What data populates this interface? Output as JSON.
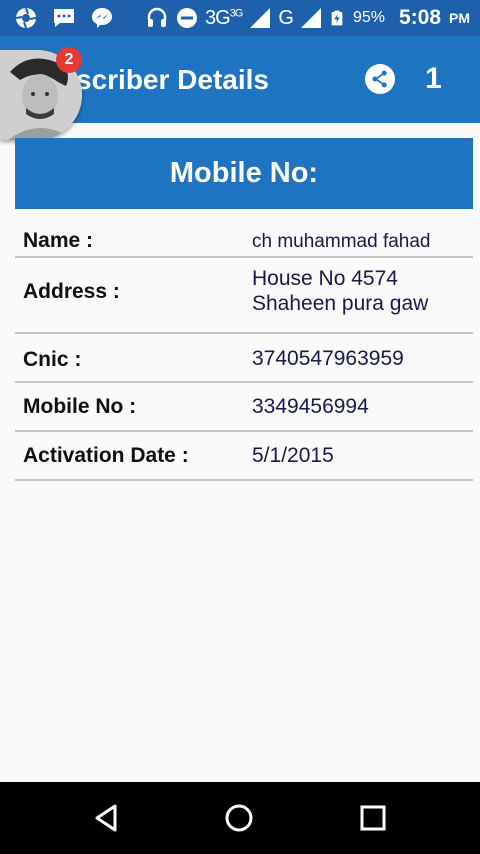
{
  "status_bar": {
    "network_3g": "3G",
    "network_3g_small": "3G",
    "network_g": "G",
    "battery_percent": "95%",
    "time": "5:08",
    "ampm": "PM",
    "icons": [
      "aperture-icon",
      "chat-icon",
      "messenger-icon",
      "headset-icon",
      "dnd-icon",
      "signal-icon",
      "battery-icon"
    ]
  },
  "app_bar": {
    "title": "scriber Details",
    "count": "1",
    "notification_badge": "2",
    "colors": {
      "primary": "#1f74c1",
      "status": "#1f60ad"
    }
  },
  "section": {
    "header": "Mobile No:"
  },
  "details": {
    "name_label": "Name :",
    "name_value": "ch muhammad fahad",
    "address_label": "Address :",
    "address_line1": "House No 4574",
    "address_line2": "Shaheen pura gaw",
    "cnic_label": "Cnic :",
    "cnic_value": "3740547963959",
    "mobile_label": "Mobile No :",
    "mobile_value": "3349456994",
    "activation_label": "Activation Date :",
    "activation_value": "5/1/2015"
  }
}
